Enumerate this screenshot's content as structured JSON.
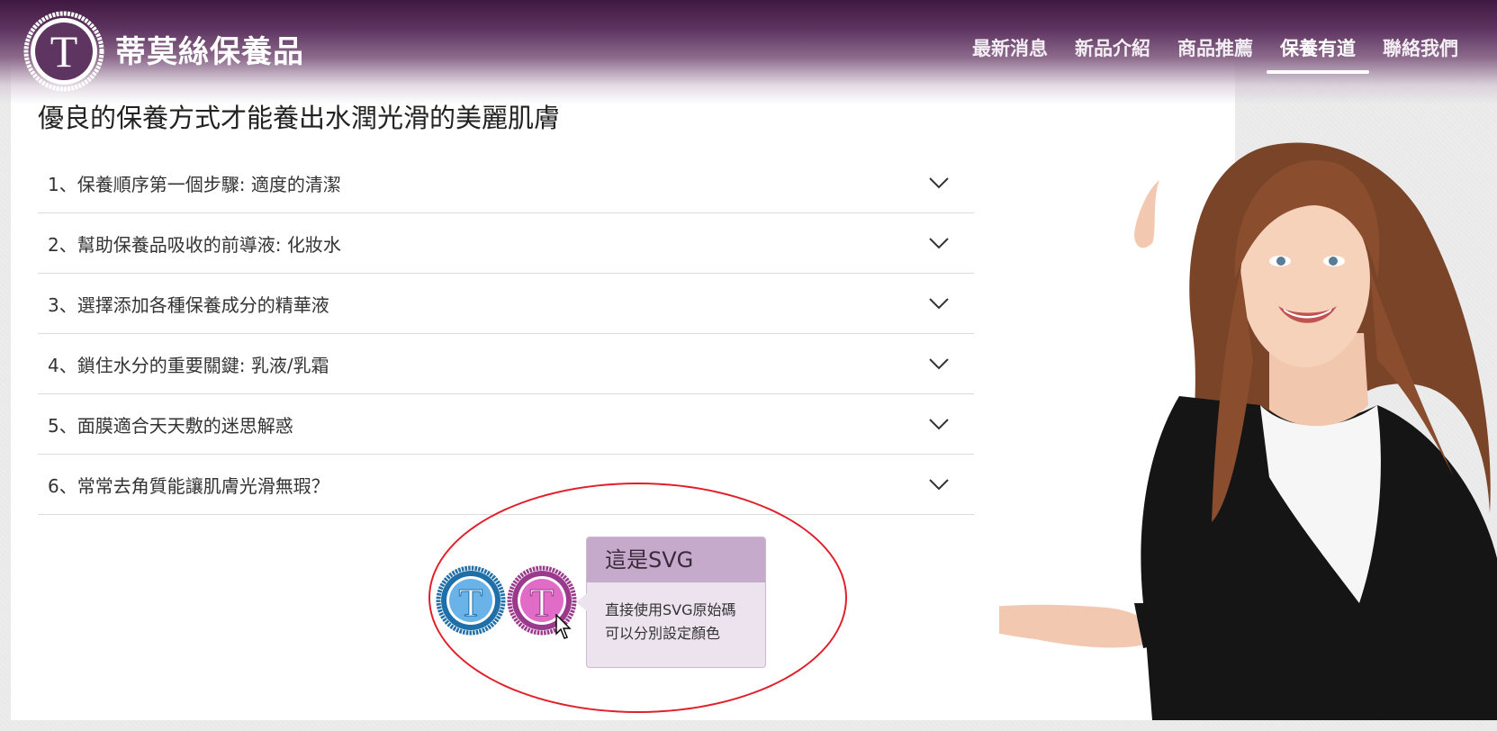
{
  "site": {
    "title": "蒂莫絲保養品",
    "logo_icon": "t-circle-logo-icon"
  },
  "nav": {
    "items": [
      {
        "label": "最新消息",
        "active": false
      },
      {
        "label": "新品介紹",
        "active": false
      },
      {
        "label": "商品推薦",
        "active": false
      },
      {
        "label": "保養有道",
        "active": true
      },
      {
        "label": "聯絡我們",
        "active": false
      }
    ]
  },
  "page": {
    "heading": "優良的保養方式才能養出水潤光滑的美麗肌膚"
  },
  "accordion": {
    "items": [
      {
        "label": "1、保養順序第一個步驟: 適度的清潔"
      },
      {
        "label": "2、幫助保養品吸收的前導液: 化妝水"
      },
      {
        "label": "3、選擇添加各種保養成分的精華液"
      },
      {
        "label": "4、鎖住水分的重要關鍵: 乳液/乳霜"
      },
      {
        "label": "5、面膜適合天天敷的迷思解惑"
      },
      {
        "label": "6、常常去角質能讓肌膚光滑無瑕？"
      }
    ]
  },
  "tooltip": {
    "title": "這是SVG",
    "line1": "直接使用SVG原始碼",
    "line2": "可以分別設定顏色"
  },
  "colors": {
    "header_dark": "#3f1941",
    "badge_blue_ring": "#1f6fa8",
    "badge_blue_fill": "#6ab3e8",
    "badge_purple_ring": "#9b3a8c",
    "badge_purple_fill": "#e06cc8",
    "ellipse": "#e01f2a",
    "tooltip_header": "#c6aacb"
  },
  "icons": [
    "t-circle-logo-icon",
    "chevron-down-icon",
    "cursor-arrow-icon"
  ]
}
